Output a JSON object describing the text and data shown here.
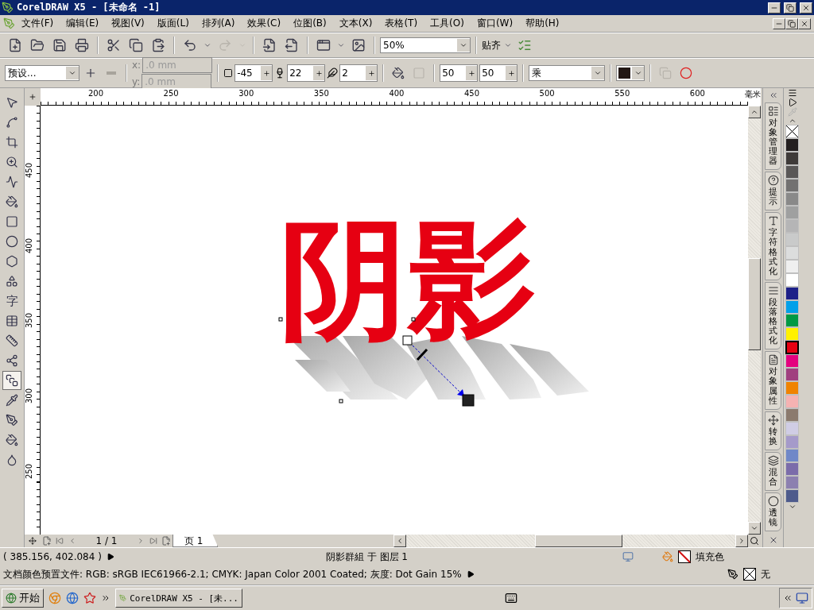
{
  "window": {
    "title": "CorelDRAW X5 - [未命名 -1]"
  },
  "menu": [
    "文件(F)",
    "编辑(E)",
    "视图(V)",
    "版面(L)",
    "排列(A)",
    "效果(C)",
    "位图(B)",
    "文本(X)",
    "表格(T)",
    "工具(O)",
    "窗口(W)",
    "帮助(H)"
  ],
  "toolbar": {
    "groups": [
      [
        {
          "kind": "new",
          "disabled": false
        },
        {
          "kind": "open",
          "disabled": false
        },
        {
          "kind": "save",
          "disabled": false
        },
        {
          "kind": "print",
          "disabled": false
        }
      ],
      [
        {
          "kind": "cut",
          "disabled": false
        },
        {
          "kind": "copy",
          "disabled": false
        },
        {
          "kind": "paste",
          "disabled": false
        }
      ],
      [
        {
          "kind": "undo",
          "disabled": false
        },
        {
          "kind": "dropdown",
          "disabled": false
        },
        {
          "kind": "redo",
          "disabled": true
        },
        {
          "kind": "dropdown",
          "disabled": true
        }
      ],
      [
        {
          "kind": "import",
          "disabled": false
        },
        {
          "kind": "export",
          "disabled": false
        }
      ],
      [
        {
          "kind": "launcher",
          "disabled": false
        },
        {
          "kind": "dropdown",
          "disabled": false
        },
        {
          "kind": "welcome",
          "disabled": false
        }
      ]
    ],
    "zoom": "50%",
    "snap": "贴齐"
  },
  "property_bar": {
    "preset": "预设...",
    "x_label": "x:",
    "x": ".0 mm",
    "y_label": "y:",
    "y": ".0 mm",
    "position_disabled": true,
    "angle": "-45",
    "opacity": "22",
    "feathering": "2",
    "fade": "50",
    "stretch": "50",
    "merge_mode": "乘"
  },
  "tools": [
    {
      "kind": "pick",
      "selected": false
    },
    {
      "kind": "shape",
      "selected": false
    },
    {
      "kind": "crop",
      "selected": false
    },
    {
      "kind": "zoom",
      "selected": false
    },
    {
      "kind": "freehand",
      "selected": false
    },
    {
      "kind": "smartfill",
      "selected": false
    },
    {
      "kind": "rectangle",
      "selected": false
    },
    {
      "kind": "ellipse",
      "selected": false
    },
    {
      "kind": "polygon",
      "selected": false
    },
    {
      "kind": "shapes",
      "selected": false
    },
    {
      "kind": "text",
      "glyph": "字",
      "selected": false
    },
    {
      "kind": "table",
      "selected": false
    },
    {
      "kind": "dimension",
      "selected": false
    },
    {
      "kind": "connector",
      "selected": false
    },
    {
      "kind": "shadow",
      "selected": true
    },
    {
      "kind": "eyedropper",
      "selected": false
    },
    {
      "kind": "outline",
      "selected": false
    },
    {
      "kind": "fill",
      "selected": false
    },
    {
      "kind": "interactive",
      "selected": false
    }
  ],
  "rulers": {
    "unit": "毫米",
    "horizontal": [
      "200",
      "250",
      "300",
      "350",
      "400",
      "450",
      "500",
      "550",
      "600"
    ],
    "vertical": [
      "450",
      "400",
      "350",
      "300",
      "250"
    ]
  },
  "canvas": {
    "text": "阴影"
  },
  "dockers": [
    {
      "kind": "objects",
      "label": "对象管理器"
    },
    {
      "kind": "hints",
      "label": "提示"
    },
    {
      "kind": "character",
      "label": "字符格式化"
    },
    {
      "kind": "paragraph",
      "label": "段落格式化"
    },
    {
      "kind": "properties",
      "label": "对象属性"
    },
    {
      "kind": "transform",
      "label": "转换"
    },
    {
      "kind": "blend",
      "label": "混合"
    },
    {
      "kind": "lens",
      "label": "透镜"
    }
  ],
  "palette": [
    {
      "kind": "none",
      "selected": false
    },
    {
      "kind": "swatch",
      "color": "#231f20",
      "selected": false
    },
    {
      "kind": "swatch",
      "color": "#3e3a39",
      "selected": false
    },
    {
      "kind": "swatch",
      "color": "#595757",
      "selected": false
    },
    {
      "kind": "swatch",
      "color": "#727171",
      "selected": false
    },
    {
      "kind": "swatch",
      "color": "#898989",
      "selected": false
    },
    {
      "kind": "swatch",
      "color": "#9fa0a0",
      "selected": false
    },
    {
      "kind": "swatch",
      "color": "#b5b5b6",
      "selected": false
    },
    {
      "kind": "swatch",
      "color": "#c9caca",
      "selected": false
    },
    {
      "kind": "swatch",
      "color": "#dcdddd",
      "selected": false
    },
    {
      "kind": "swatch",
      "color": "#efefef",
      "selected": false
    },
    {
      "kind": "swatch",
      "color": "#ffffff",
      "selected": false
    },
    {
      "kind": "swatch",
      "color": "#1d2088",
      "selected": false
    },
    {
      "kind": "swatch",
      "color": "#00a0e9",
      "selected": false
    },
    {
      "kind": "swatch",
      "color": "#009944",
      "selected": false
    },
    {
      "kind": "swatch",
      "color": "#fff100",
      "selected": false
    },
    {
      "kind": "swatch",
      "color": "#e60012",
      "selected": true
    },
    {
      "kind": "swatch",
      "color": "#e4007f",
      "selected": false
    },
    {
      "kind": "swatch",
      "color": "#a0407f",
      "selected": false
    },
    {
      "kind": "swatch",
      "color": "#f08300",
      "selected": false
    },
    {
      "kind": "swatch",
      "color": "#f5b2b2",
      "selected": false
    },
    {
      "kind": "swatch",
      "color": "#8b7a6e",
      "selected": false
    },
    {
      "kind": "swatch",
      "color": "#d0cde5",
      "selected": false
    },
    {
      "kind": "swatch",
      "color": "#a59aca",
      "selected": false
    },
    {
      "kind": "swatch",
      "color": "#7088c8",
      "selected": false
    },
    {
      "kind": "swatch",
      "color": "#7b6caa",
      "selected": false
    },
    {
      "kind": "swatch",
      "color": "#8c80b0",
      "selected": false
    },
    {
      "kind": "swatch",
      "color": "#4e5b8c",
      "selected": false
    }
  ],
  "page_nav": {
    "counter": "1 / 1",
    "tabs": [
      {
        "label": "页 1",
        "selected": true
      }
    ]
  },
  "status": {
    "coordinates": "( 385.156, 402.084 )",
    "selection": "阴影群組 于 图层 1",
    "fill_label": "填充色",
    "outline_label": "无",
    "color_profile": "文档颜色预置文件: RGB: sRGB IEC61966-2.1; CMYK: Japan Color 2001 Coated; 灰度: Dot Gain 15%"
  },
  "taskbar": {
    "start": "开始",
    "tasks": [
      {
        "label": "CorelDRAW X5 - [未...",
        "selected": false
      }
    ]
  }
}
